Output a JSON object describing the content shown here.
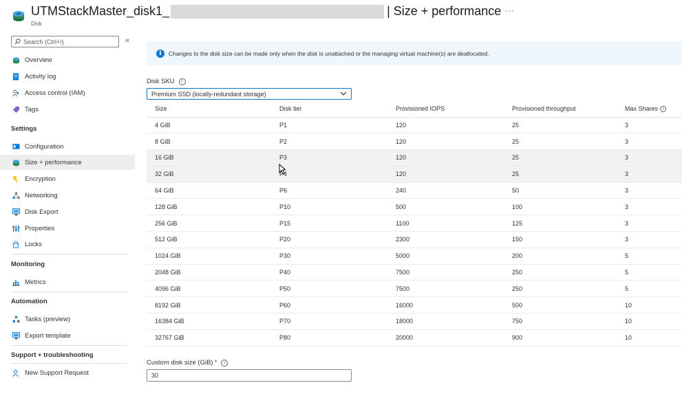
{
  "header": {
    "title_prefix": "UTMStackMaster_disk1_",
    "title_suffix": "| Size + performance",
    "subtitle": "Disk",
    "more": "···"
  },
  "sidebar": {
    "search_placeholder": "Search (Ctrl+/)",
    "collapse": "«",
    "top_items": [
      {
        "label": "Overview",
        "icon": "disk-icon"
      },
      {
        "label": "Activity log",
        "icon": "activity-log-icon"
      },
      {
        "label": "Access control (IAM)",
        "icon": "people-icon"
      },
      {
        "label": "Tags",
        "icon": "tag-icon"
      }
    ],
    "sections": [
      {
        "title": "Settings",
        "items": [
          {
            "label": "Configuration",
            "icon": "configuration-icon"
          },
          {
            "label": "Size + performance",
            "icon": "disk-icon",
            "active": true
          },
          {
            "label": "Encryption",
            "icon": "key-icon"
          },
          {
            "label": "Networking",
            "icon": "network-icon"
          },
          {
            "label": "Disk Export",
            "icon": "export-icon"
          },
          {
            "label": "Properties",
            "icon": "properties-icon"
          },
          {
            "label": "Locks",
            "icon": "lock-icon"
          }
        ]
      },
      {
        "title": "Monitoring",
        "items": [
          {
            "label": "Metrics",
            "icon": "metrics-icon"
          }
        ]
      },
      {
        "title": "Automation",
        "items": [
          {
            "label": "Tasks (preview)",
            "icon": "tasks-icon"
          },
          {
            "label": "Export template",
            "icon": "template-icon"
          }
        ]
      },
      {
        "title": "Support + troubleshooting",
        "items": [
          {
            "label": "New Support Request",
            "icon": "support-icon"
          }
        ]
      }
    ]
  },
  "main": {
    "info_text": "Changes to the disk size can be made only when the disk is unattached or the managing virtual machine(s) are deallocated.",
    "sku_label": "Disk SKU",
    "sku_value": "Premium SSD (locally-redundant storage)",
    "table": {
      "headers": [
        "Size",
        "Disk tier",
        "Provisioned IOPS",
        "Provisioned throughput",
        "Max Shares"
      ],
      "rows": [
        [
          "4 GiB",
          "P1",
          "120",
          "25",
          "3"
        ],
        [
          "8 GiB",
          "P2",
          "120",
          "25",
          "3"
        ],
        [
          "16 GiB",
          "P3",
          "120",
          "25",
          "3"
        ],
        [
          "32 GiB",
          "P4",
          "120",
          "25",
          "3"
        ],
        [
          "64 GiB",
          "P6",
          "240",
          "50",
          "3"
        ],
        [
          "128 GiB",
          "P10",
          "500",
          "100",
          "3"
        ],
        [
          "256 GiB",
          "P15",
          "1100",
          "125",
          "3"
        ],
        [
          "512 GiB",
          "P20",
          "2300",
          "150",
          "3"
        ],
        [
          "1024 GiB",
          "P30",
          "5000",
          "200",
          "5"
        ],
        [
          "2048 GiB",
          "P40",
          "7500",
          "250",
          "5"
        ],
        [
          "4096 GiB",
          "P50",
          "7500",
          "250",
          "5"
        ],
        [
          "8192 GiB",
          "P60",
          "16000",
          "500",
          "10"
        ],
        [
          "16384 GiB",
          "P70",
          "18000",
          "750",
          "10"
        ],
        [
          "32767 GiB",
          "P80",
          "20000",
          "900",
          "10"
        ]
      ],
      "highlighted_rows": [
        2,
        3
      ]
    },
    "custom_size_label": "Custom disk size (GiB)",
    "custom_size_required": "*",
    "custom_size_value": "30"
  },
  "colors": {
    "accent": "#0078d4",
    "info_bg": "#eff6fc",
    "active_nav": "#eeeeee"
  }
}
